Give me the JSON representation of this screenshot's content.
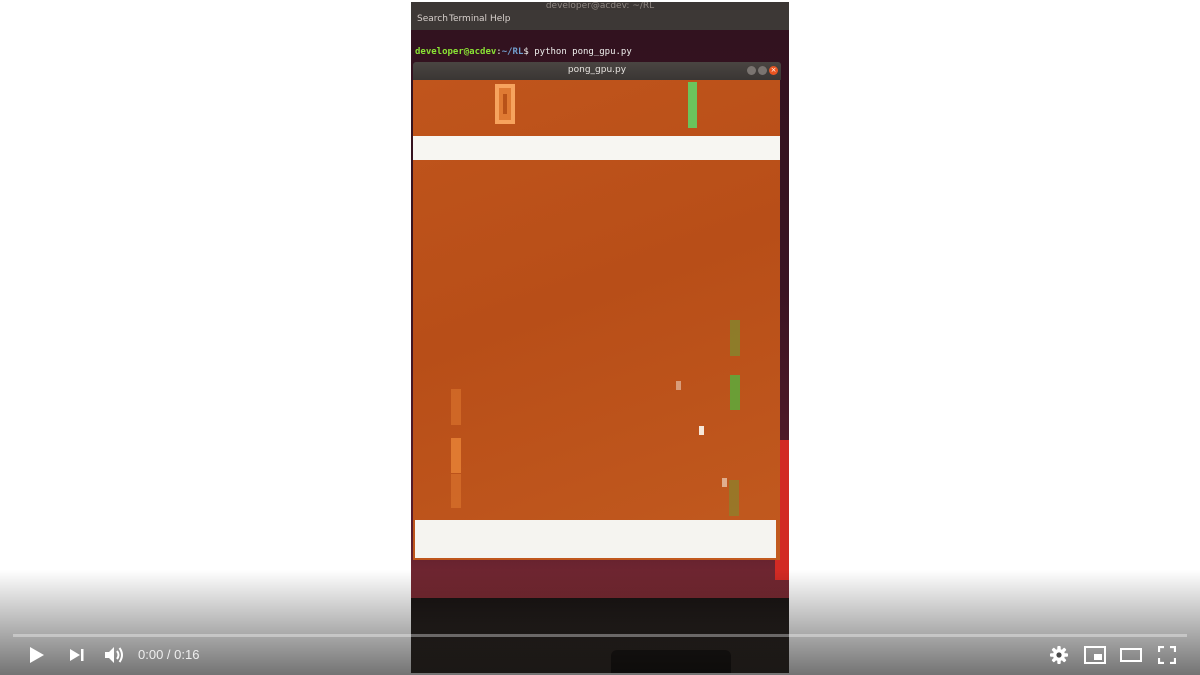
{
  "terminal": {
    "window_title": "developer@acdev: ~/RL",
    "menu": [
      "Search",
      "Terminal",
      "Help"
    ],
    "prompt_user": "developer@acdev",
    "prompt_sep": ":",
    "prompt_path": "~/RL",
    "prompt_symbol": "$",
    "command": "python pong_gpu.py"
  },
  "game_window": {
    "title": "pong_gpu.py",
    "close_glyph": "×"
  },
  "player": {
    "current_time": "0:00",
    "separator": " / ",
    "duration": "0:16",
    "progress_fraction": 0,
    "icons": [
      "play-icon",
      "next-icon",
      "volume-icon",
      "settings-icon",
      "miniplayer-icon",
      "theater-mode-icon",
      "fullscreen-icon"
    ]
  },
  "colors": {
    "game_background": "#bf551c",
    "left_player": "#e07a31",
    "right_player": "#6bc45c",
    "walls": "#f7f6f2"
  }
}
